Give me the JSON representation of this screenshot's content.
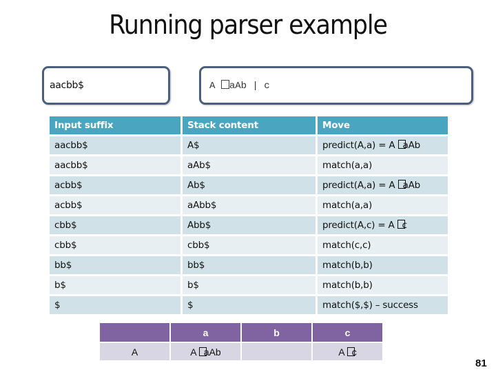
{
  "slide": {
    "title": "Running parser example",
    "page_number": "81"
  },
  "input_box": {
    "text": "aacbb$"
  },
  "grammar_box": {
    "lhs": "A",
    "arrow_icon": "arrow-glyph-missing-box",
    "rhs": "aAb | c"
  },
  "trace_table": {
    "headers": [
      "Input suffix",
      "Stack content",
      "Move"
    ],
    "rows": [
      {
        "input": "aacbb$",
        "stack": "A$",
        "move_prefix": "predict(A,a) = A ",
        "move_arrow": true,
        "move_suffix": "aAb"
      },
      {
        "input": "aacbb$",
        "stack": "aAb$",
        "move_prefix": "match(a,a)",
        "move_arrow": false,
        "move_suffix": ""
      },
      {
        "input": "acbb$",
        "stack": "Ab$",
        "move_prefix": "predict(A,a) = A ",
        "move_arrow": true,
        "move_suffix": "aAb"
      },
      {
        "input": "acbb$",
        "stack": "aAbb$",
        "move_prefix": "match(a,a)",
        "move_arrow": false,
        "move_suffix": ""
      },
      {
        "input": "cbb$",
        "stack": "Abb$",
        "move_prefix": "predict(A,c) = A ",
        "move_arrow": true,
        "move_suffix": "c"
      },
      {
        "input": "cbb$",
        "stack": "cbb$",
        "move_prefix": "match(c,c)",
        "move_arrow": false,
        "move_suffix": ""
      },
      {
        "input": "bb$",
        "stack": "bb$",
        "move_prefix": "match(b,b)",
        "move_arrow": false,
        "move_suffix": ""
      },
      {
        "input": "b$",
        "stack": "b$",
        "move_prefix": "match(b,b)",
        "move_arrow": false,
        "move_suffix": ""
      },
      {
        "input": "$",
        "stack": "$",
        "move_prefix": "match($,$) – success",
        "move_arrow": false,
        "move_suffix": ""
      }
    ]
  },
  "parse_table": {
    "headers": [
      "",
      "a",
      "b",
      "c"
    ],
    "row": {
      "nonterminal": "A",
      "a": {
        "prefix": "A ",
        "suffix": "aAb"
      },
      "b": {
        "prefix": "",
        "suffix": ""
      },
      "c": {
        "prefix": "A ",
        "suffix": "c"
      }
    }
  },
  "colors": {
    "box_border": "#4a5f7e",
    "trace_header": "#4aa5c0",
    "trace_row_odd": "#d0e1e8",
    "trace_row_even": "#e8eff2",
    "parse_header": "#8064a2",
    "parse_row": "#d9d6e3"
  }
}
